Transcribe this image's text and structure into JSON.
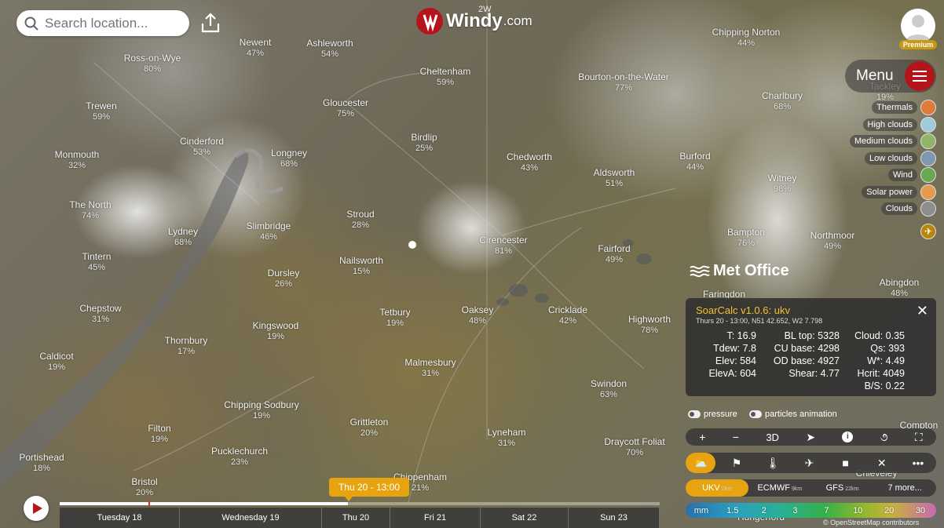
{
  "search": {
    "placeholder": "Search location..."
  },
  "brand": {
    "name": "Windy",
    "suffix": ".com"
  },
  "account": {
    "badge": "Premium"
  },
  "menu": {
    "label": "Menu"
  },
  "map_grid_label": "2W",
  "layers": [
    {
      "label": "Thermals",
      "color": "#e07a3a"
    },
    {
      "label": "High clouds",
      "color": "#9fcbd8"
    },
    {
      "label": "Medium clouds",
      "color": "#8fb46a"
    },
    {
      "label": "Low clouds",
      "color": "#7f97b0"
    },
    {
      "label": "Wind",
      "color": "#6aa84f"
    },
    {
      "label": "Solar power",
      "color": "#e69a50"
    },
    {
      "label": "Clouds",
      "color": "#8e8e8e"
    }
  ],
  "provider_logo": "Met Office",
  "towns": [
    {
      "name": "Newent",
      "pct": "47%"
    },
    {
      "name": "Ashleworth",
      "pct": "54%"
    },
    {
      "name": "Ross-on-Wye",
      "pct": "80%"
    },
    {
      "name": "Gloucester",
      "pct": "75%"
    },
    {
      "name": "Cheltenham",
      "pct": "59%"
    },
    {
      "name": "Bourton-on-the-Water",
      "pct": "77%"
    },
    {
      "name": "Chipping Norton",
      "pct": "44%"
    },
    {
      "name": "Charlbury",
      "pct": "68%"
    },
    {
      "name": "Tackley",
      "pct": "19%"
    },
    {
      "name": "Trewen",
      "pct": "59%"
    },
    {
      "name": "Cinderford",
      "pct": "53%"
    },
    {
      "name": "Longney",
      "pct": "68%"
    },
    {
      "name": "Birdlip",
      "pct": "25%"
    },
    {
      "name": "Chedworth",
      "pct": "43%"
    },
    {
      "name": "Aldsworth",
      "pct": "51%"
    },
    {
      "name": "Burford",
      "pct": "44%"
    },
    {
      "name": "Witney",
      "pct": "98%"
    },
    {
      "name": "Monmouth",
      "pct": "32%"
    },
    {
      "name": "The North",
      "pct": "74%"
    },
    {
      "name": "Lydney",
      "pct": "68%"
    },
    {
      "name": "Slimbridge",
      "pct": "46%"
    },
    {
      "name": "Stroud",
      "pct": "28%"
    },
    {
      "name": "Cirencester",
      "pct": "81%"
    },
    {
      "name": "Fairford",
      "pct": "49%"
    },
    {
      "name": "Bampton",
      "pct": "76%"
    },
    {
      "name": "Northmoor",
      "pct": "49%"
    },
    {
      "name": "Abingdon",
      "pct": "48%"
    },
    {
      "name": "Faringdon",
      "pct": ""
    },
    {
      "name": "Tintern",
      "pct": "45%"
    },
    {
      "name": "Nailsworth",
      "pct": "15%"
    },
    {
      "name": "Dursley",
      "pct": "26%"
    },
    {
      "name": "Chepstow",
      "pct": "31%"
    },
    {
      "name": "Tetbury",
      "pct": "19%"
    },
    {
      "name": "Oaksey",
      "pct": "48%"
    },
    {
      "name": "Cricklade",
      "pct": "42%"
    },
    {
      "name": "Highworth",
      "pct": "78%"
    },
    {
      "name": "Kingswood",
      "pct": "19%"
    },
    {
      "name": "Thornbury",
      "pct": "17%"
    },
    {
      "name": "Caldicot",
      "pct": "19%"
    },
    {
      "name": "Malmesbury",
      "pct": "31%"
    },
    {
      "name": "Swindon",
      "pct": "63%"
    },
    {
      "name": "Chipping Sodbury",
      "pct": "19%"
    },
    {
      "name": "Grittleton",
      "pct": "20%"
    },
    {
      "name": "Filton",
      "pct": "19%"
    },
    {
      "name": "Lyneham",
      "pct": "31%"
    },
    {
      "name": "Draycott Foliat",
      "pct": "70%"
    },
    {
      "name": "Compton",
      "pct": ""
    },
    {
      "name": "Portishead",
      "pct": "18%"
    },
    {
      "name": "Pucklechurch",
      "pct": "23%"
    },
    {
      "name": "Bristol",
      "pct": "20%"
    },
    {
      "name": "Chippenham",
      "pct": "21%"
    },
    {
      "name": "Chieveley",
      "pct": ""
    },
    {
      "name": "Hungerford",
      "pct": ""
    }
  ],
  "soarcalc": {
    "title": "SoarCalc v1.0.6: ukv",
    "subtitle": "Thurs 20 - 13:00, N51 42.652, W2 7.798",
    "col1": [
      "T: 16.9",
      "Tdew: 7.8",
      "Elev: 584",
      "ElevA: 604"
    ],
    "col2": [
      "BL top: 5328",
      "CU base: 4298",
      "OD base: 4927",
      "Shear: 4.77"
    ],
    "col3": [
      "Cloud: 0.35",
      "Qs: 393",
      "W*: 4.49",
      "Hcrit: 4049",
      "B/S: 0.22"
    ]
  },
  "toggles": {
    "pressure": "pressure",
    "particles": "particles animation"
  },
  "tools": {
    "plus": "+",
    "minus": "−",
    "three_d": "3D"
  },
  "models": [
    {
      "name": "UKV",
      "res": "2km",
      "selected": true
    },
    {
      "name": "ECMWF",
      "res": "9km"
    },
    {
      "name": "GFS",
      "res": "22km"
    },
    {
      "name": "7 more...",
      "res": ""
    }
  ],
  "scale": {
    "unit": "mm",
    "ticks": [
      "1.5",
      "2",
      "3",
      "7",
      "10",
      "20",
      "30"
    ]
  },
  "attribution": "© OpenStreetMap contributors",
  "timeline": {
    "current": "Thu 20 - 13:00",
    "progress_fraction": 0.48,
    "days": [
      "Tuesday 18",
      "Wednesday 19",
      "Thu 20",
      "Fri 21",
      "Sat 22",
      "Sun 23"
    ]
  }
}
